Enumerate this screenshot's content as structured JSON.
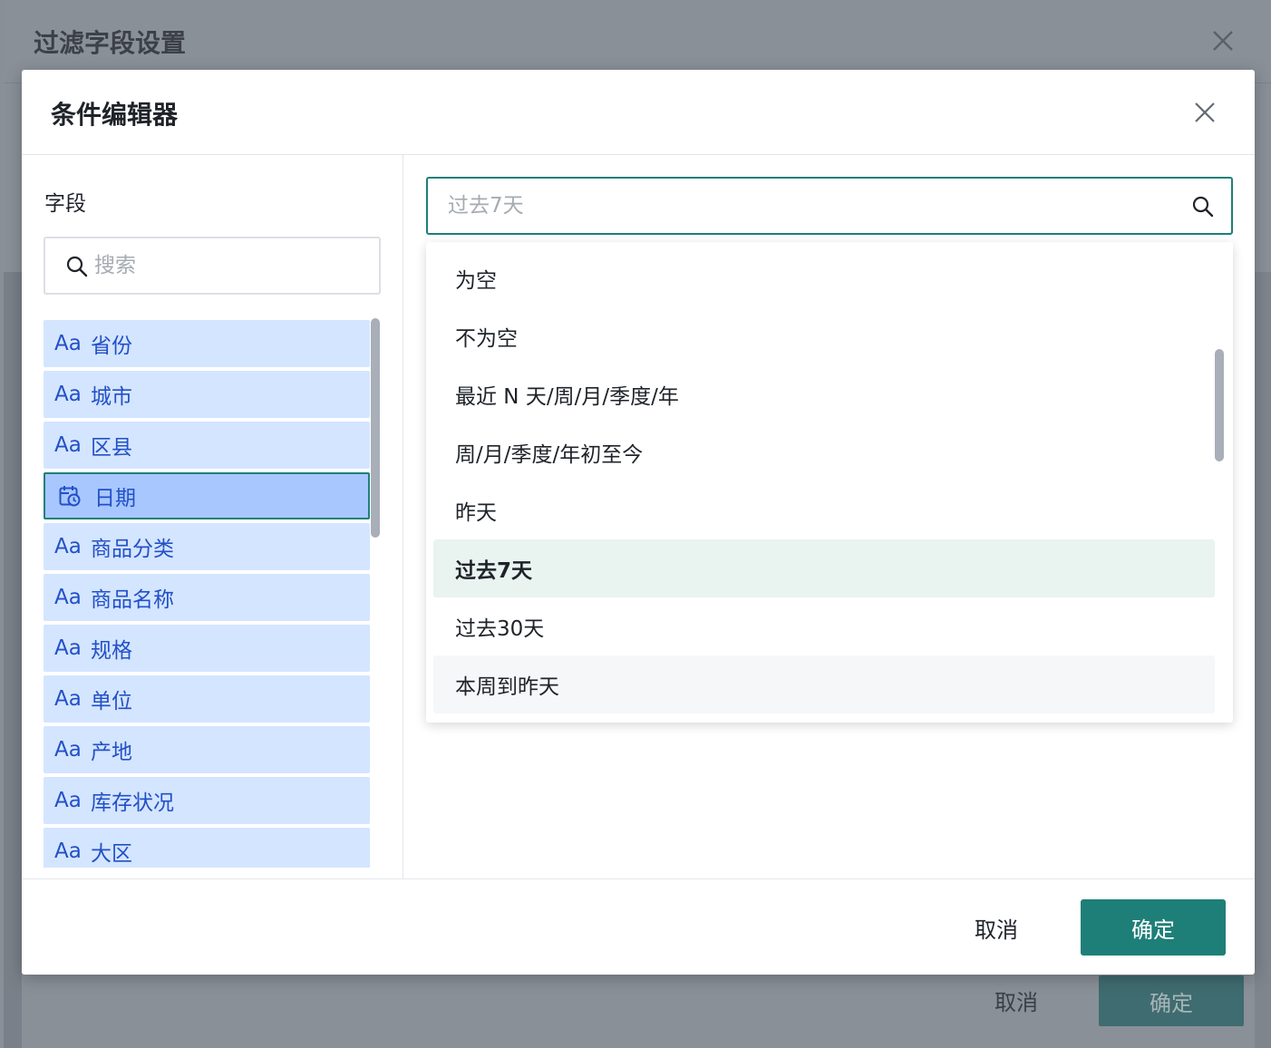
{
  "outer_dialog": {
    "title": "过滤字段设置",
    "cancel_label": "取消",
    "ok_label": "确定"
  },
  "dialog": {
    "title": "条件编辑器",
    "fields_label": "字段",
    "field_search_placeholder": "搜索",
    "fields": [
      {
        "type": "Aa",
        "name": "省份"
      },
      {
        "type": "Aa",
        "name": "城市"
      },
      {
        "type": "Aa",
        "name": "区县"
      },
      {
        "type": "calendar-icon",
        "name": "日期",
        "selected": true
      },
      {
        "type": "Aa",
        "name": "商品分类"
      },
      {
        "type": "Aa",
        "name": "商品名称"
      },
      {
        "type": "Aa",
        "name": "规格"
      },
      {
        "type": "Aa",
        "name": "单位"
      },
      {
        "type": "Aa",
        "name": "产地"
      },
      {
        "type": "Aa",
        "name": "库存状况"
      },
      {
        "type": "Aa",
        "name": "大区"
      }
    ],
    "condition_search_placeholder": "过去7天",
    "condition_options": [
      "为空",
      "不为空",
      "最近 N 天/周/月/季度/年",
      "周/月/季度/年初至今",
      "昨天",
      "过去7天",
      "过去30天",
      "本周到昨天"
    ],
    "selected_condition": "过去7天",
    "cancel_label": "取消",
    "ok_label": "确定"
  },
  "colors": {
    "accent": "#1e7f78",
    "field_bg": "#d4e5ff",
    "field_selected_bg": "#a8c7ff",
    "field_text": "#2250c8",
    "selected_option_bg": "#e9f3f0"
  }
}
